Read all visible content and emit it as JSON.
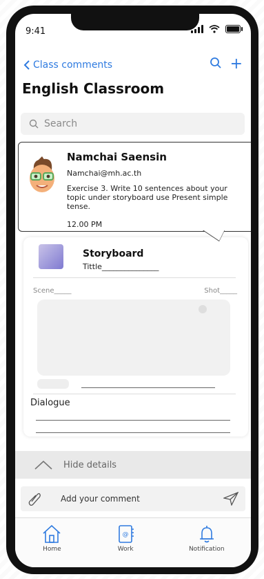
{
  "status_bar": {
    "time": "9:41"
  },
  "nav": {
    "back_label": "Class comments"
  },
  "page_title": "English Classroom",
  "search": {
    "placeholder": "Search"
  },
  "comment": {
    "author": "Namchai Saensin",
    "email": "Namchai@mh.ac.th",
    "message": "Exercise 3. Write 10 sentences about your topic under storyboard use Present simple tense.",
    "time": "12.00 PM"
  },
  "storyboard": {
    "title": "Storyboard",
    "subtitle": "Tittle_______________",
    "scene_label": "Scene_____",
    "shot_label": "Shot_____",
    "dialogue_label": "Dialogue"
  },
  "hide_details": {
    "label": "Hide details"
  },
  "comment_input": {
    "placeholder": "Add your comment"
  },
  "tabs": [
    {
      "label": "Home"
    },
    {
      "label": "Work"
    },
    {
      "label": "Notification"
    }
  ],
  "colors": {
    "accent": "#2f7be0"
  }
}
